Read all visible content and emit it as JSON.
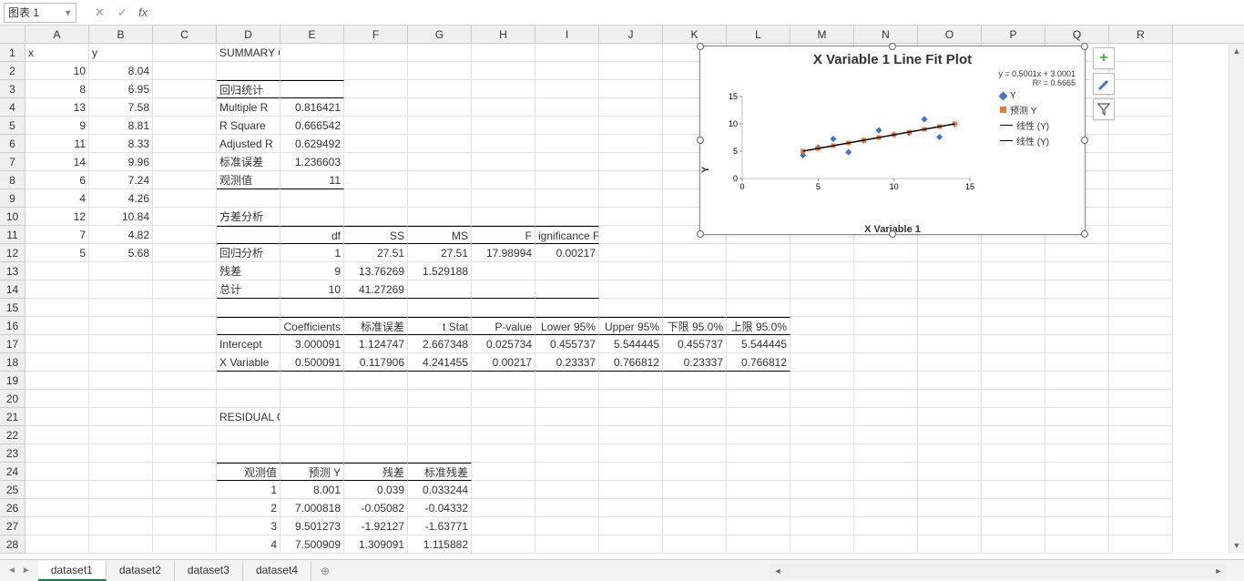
{
  "name_box": "图表 1",
  "columns": [
    "A",
    "B",
    "C",
    "D",
    "E",
    "F",
    "G",
    "H",
    "I",
    "J",
    "K",
    "L",
    "M",
    "N",
    "O",
    "P",
    "Q",
    "R"
  ],
  "data_xy": {
    "header": [
      "x",
      "y"
    ],
    "rows": [
      [
        10,
        8.04
      ],
      [
        8,
        6.95
      ],
      [
        13,
        7.58
      ],
      [
        9,
        8.81
      ],
      [
        11,
        8.33
      ],
      [
        14,
        9.96
      ],
      [
        6,
        7.24
      ],
      [
        4,
        4.26
      ],
      [
        12,
        10.84
      ],
      [
        7,
        4.82
      ],
      [
        5,
        5.68
      ]
    ]
  },
  "summary_title": "SUMMARY OUTPUT",
  "reg_stats": {
    "title": "回归统计",
    "rows": [
      [
        "Multiple R",
        0.816421
      ],
      [
        "R Square",
        0.666542
      ],
      [
        "Adjusted R",
        0.629492
      ],
      [
        "标准误差",
        1.236603
      ],
      [
        "观测值",
        11
      ]
    ]
  },
  "anova": {
    "title": "方差分析",
    "headers": [
      "",
      "df",
      "SS",
      "MS",
      "F",
      "ignificance F"
    ],
    "rows": [
      [
        "回归分析",
        1,
        27.51,
        27.51,
        17.98994,
        0.00217
      ],
      [
        "残差",
        9,
        13.76269,
        1.529188,
        "",
        ""
      ],
      [
        "总计",
        10,
        41.27269,
        "",
        "",
        ""
      ]
    ]
  },
  "coeff": {
    "headers": [
      "",
      "Coefficients",
      "标准误差",
      "t Stat",
      "P-value",
      "Lower 95%",
      "Upper 95%",
      "下限 95.0%",
      "上限 95.0%"
    ],
    "rows": [
      [
        "Intercept",
        3.000091,
        1.124747,
        2.667348,
        0.025734,
        0.455737,
        5.544445,
        0.455737,
        5.544445
      ],
      [
        "X Variable",
        0.500091,
        0.117906,
        4.241455,
        0.00217,
        0.23337,
        0.766812,
        0.23337,
        0.766812
      ]
    ]
  },
  "residual": {
    "title": "RESIDUAL OUTPUT",
    "headers": [
      "观测值",
      "预测 Y",
      "残差",
      "标准残差"
    ],
    "rows": [
      [
        1,
        8.001,
        0.039,
        0.033244
      ],
      [
        2,
        7.000818,
        -0.05082,
        -0.04332
      ],
      [
        3,
        9.501273,
        -1.92127,
        -1.63771
      ],
      [
        4,
        7.500909,
        1.309091,
        1.115882
      ]
    ]
  },
  "sheets": [
    "dataset1",
    "dataset2",
    "dataset3",
    "dataset4"
  ],
  "active_sheet": 0,
  "chart_data": {
    "type": "scatter",
    "title": "X Variable 1 Line Fit  Plot",
    "xlabel": "X Variable 1",
    "ylabel": "Y",
    "xlim": [
      0,
      15
    ],
    "ylim": [
      0,
      15
    ],
    "x_ticks": [
      0,
      5,
      10,
      15
    ],
    "y_ticks": [
      0,
      5,
      10,
      15
    ],
    "equation": "y = 0.5001x + 3.0001",
    "r2": "R² = 0.6665",
    "series": [
      {
        "name": "Y",
        "type": "scatter",
        "color": "#4472c4",
        "x": [
          10,
          8,
          13,
          9,
          11,
          14,
          6,
          4,
          12,
          7,
          5
        ],
        "y": [
          8.04,
          6.95,
          7.58,
          8.81,
          8.33,
          9.96,
          7.24,
          4.26,
          10.84,
          4.82,
          5.68
        ]
      },
      {
        "name": "预测 Y",
        "type": "scatter",
        "color": "#ed7d31",
        "x": [
          10,
          8,
          13,
          9,
          11,
          14,
          6,
          4,
          12,
          7,
          5
        ],
        "y": [
          8.0,
          7.0,
          9.5,
          7.5,
          8.5,
          10.0,
          6.0,
          5.0,
          9.0,
          6.5,
          5.5
        ]
      },
      {
        "name": "线性 (Y)",
        "type": "line",
        "color": "#000",
        "x": [
          4,
          14
        ],
        "y": [
          5.0,
          10.0
        ]
      },
      {
        "name": "线性 (Y)",
        "type": "line",
        "color": "#000",
        "x": [
          4,
          14
        ],
        "y": [
          5.0,
          10.0
        ]
      }
    ]
  }
}
